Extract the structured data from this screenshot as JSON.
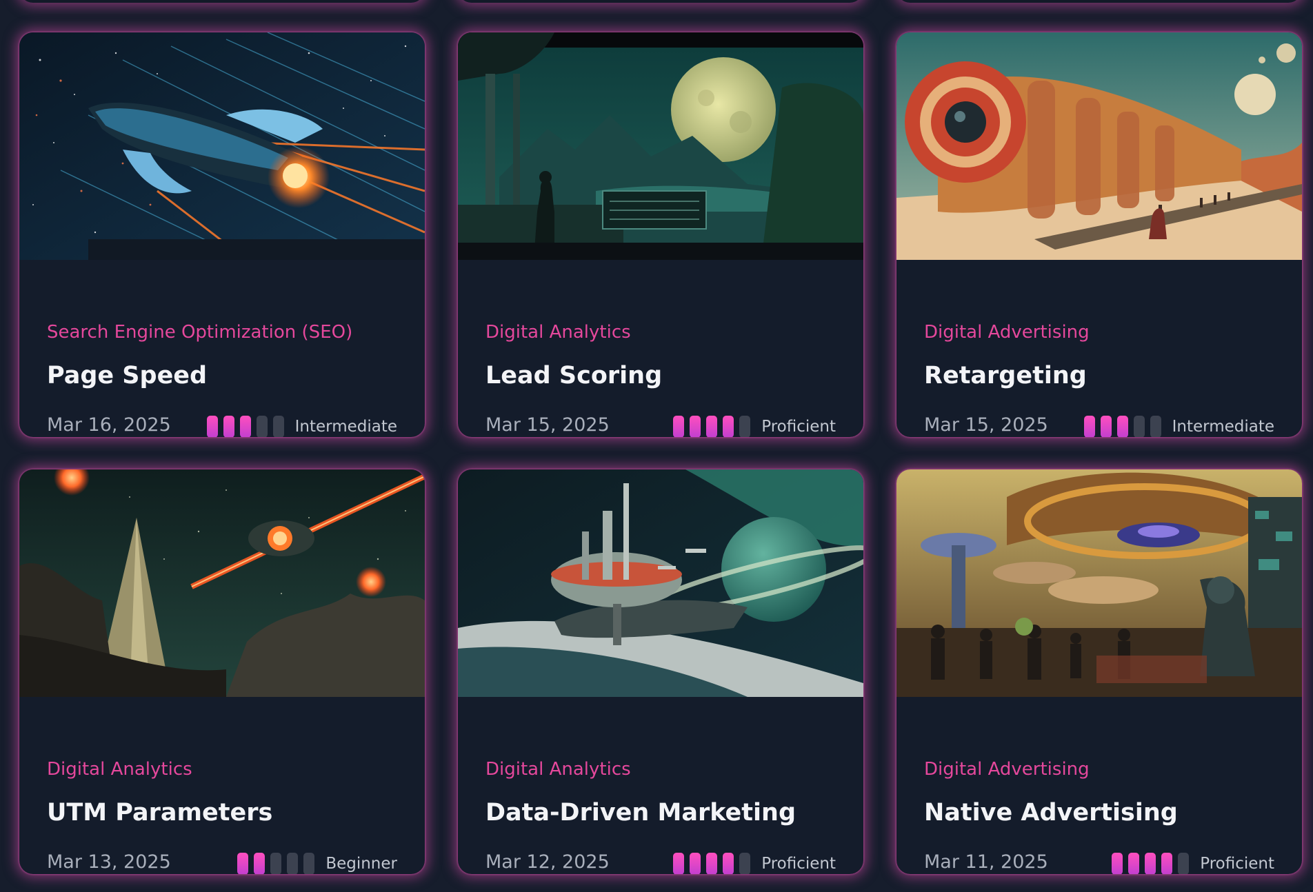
{
  "cards": [
    {
      "category": "Search Engine Optimization (SEO)",
      "title": "Page Speed",
      "date": "Mar 16, 2025",
      "level": "Intermediate",
      "level_value": 3,
      "level_max": 5,
      "image_alt": "Spaceship streaking through stars"
    },
    {
      "category": "Digital Analytics",
      "title": "Lead Scoring",
      "date": "Mar 15, 2025",
      "level": "Proficient",
      "level_value": 4,
      "level_max": 5,
      "image_alt": "Observer on terrace viewing moon over valley"
    },
    {
      "category": "Digital Advertising",
      "title": "Retargeting",
      "date": "Mar 15, 2025",
      "level": "Intermediate",
      "level_value": 3,
      "level_max": 5,
      "image_alt": "Giant orange train-ship crossing desert"
    },
    {
      "category": "Digital Analytics",
      "title": "UTM Parameters",
      "date": "Mar 13, 2025",
      "level": "Beginner",
      "level_value": 2,
      "level_max": 5,
      "image_alt": "Rocket and laser beam over rocky alien landscape"
    },
    {
      "category": "Digital Analytics",
      "title": "Data-Driven Marketing",
      "date": "Mar 12, 2025",
      "level": "Proficient",
      "level_value": 4,
      "level_max": 5,
      "image_alt": "Space station orbiting above a ringed planet"
    },
    {
      "category": "Digital Advertising",
      "title": "Native Advertising",
      "date": "Mar 11, 2025",
      "level": "Proficient",
      "level_value": 4,
      "level_max": 5,
      "image_alt": "Bustling alien marketplace under domed structures"
    }
  ],
  "colors": {
    "background": "#161d2c",
    "card": "#141c2b",
    "accent": "#e5489c",
    "glow": "#d64aa8",
    "bar_on": "#e94bc4",
    "bar_off": "#3c4250"
  }
}
